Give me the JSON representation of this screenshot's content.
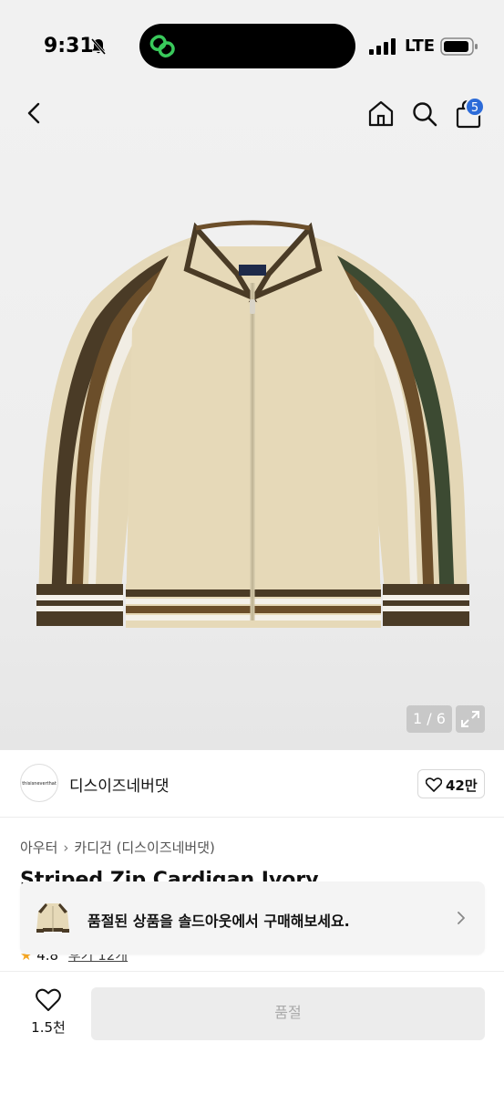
{
  "status_bar": {
    "time": "9:31",
    "network": "LTE",
    "icons": [
      "bell-off-icon",
      "link-icon",
      "signal-icon",
      "battery-icon"
    ]
  },
  "nav": {
    "icons": [
      "back-icon",
      "home-icon",
      "search-icon",
      "shopping-bag-icon"
    ],
    "cart_count": "5"
  },
  "gallery": {
    "counter": "1 / 6",
    "icons": [
      "expand-icon"
    ],
    "product_colors": {
      "body": "#e6d9b8",
      "stripe_dark": "#3a3326",
      "stripe_brown": "#6b4e2a",
      "stripe_white": "#f4f1ea"
    }
  },
  "brand": {
    "logo_text": "thisisneverthat",
    "name": "디스이즈네버댓",
    "likes": "42만",
    "icons": [
      "heart-outline-icon"
    ]
  },
  "product": {
    "category_1": "아우터",
    "category_2": "카디건 (디스이즈네버댓)",
    "title": "Striped Zip Cardigan Ivory",
    "rating": "4.8",
    "reviews": "후기 12개"
  },
  "toast": {
    "message": "품절된 상품을 솔드아웃에서 구매해보세요.",
    "icons": [
      "chevron-right-icon"
    ]
  },
  "bottom_bar": {
    "wish_count": "1.5천",
    "button_label": "품절",
    "icons": [
      "heart-outline-icon"
    ]
  },
  "colors": {
    "accent": "#2c6bd8",
    "star": "#f5a623",
    "disabled_button": "#ececec"
  }
}
